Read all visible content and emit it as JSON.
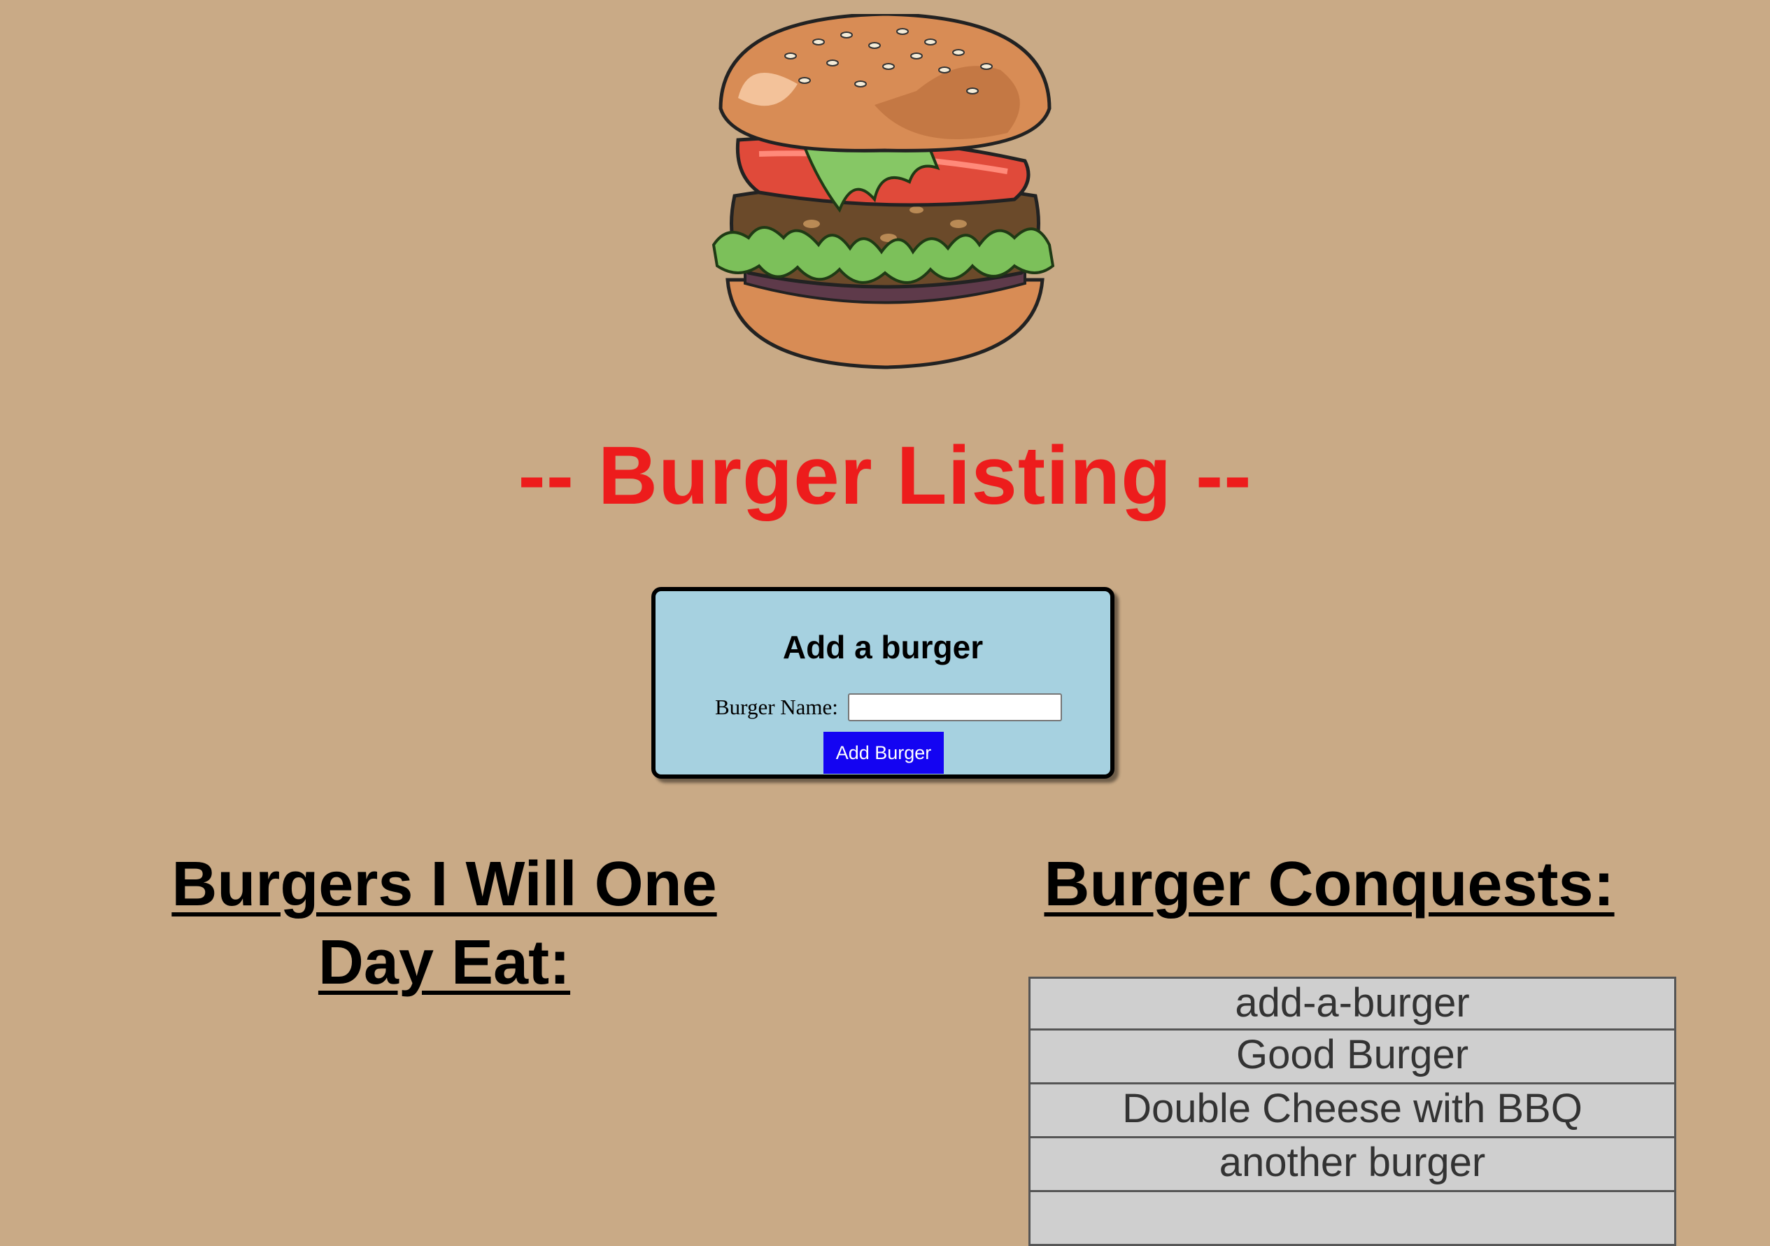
{
  "header": {
    "image": "burger-illustration",
    "title": "-- Burger Listing --"
  },
  "add_form": {
    "heading": "Add a burger",
    "label": "Burger Name:",
    "input_value": "",
    "button_label": "Add Burger"
  },
  "columns": {
    "to_eat_heading": "Burgers I Will One Day Eat:",
    "eaten_heading": "Burger Conquests:"
  },
  "to_eat": [],
  "eaten": [
    {
      "name": "add-a-burger"
    },
    {
      "name": "Good Burger"
    },
    {
      "name": "Double Cheese with BBQ"
    },
    {
      "name": "another burger"
    },
    {
      "name": ""
    }
  ],
  "colors": {
    "background": "#c9aa86",
    "title": "#ed1c1c",
    "card": "#a6d1e0",
    "button": "#1404f2",
    "list_item": "#cfcfcf"
  }
}
